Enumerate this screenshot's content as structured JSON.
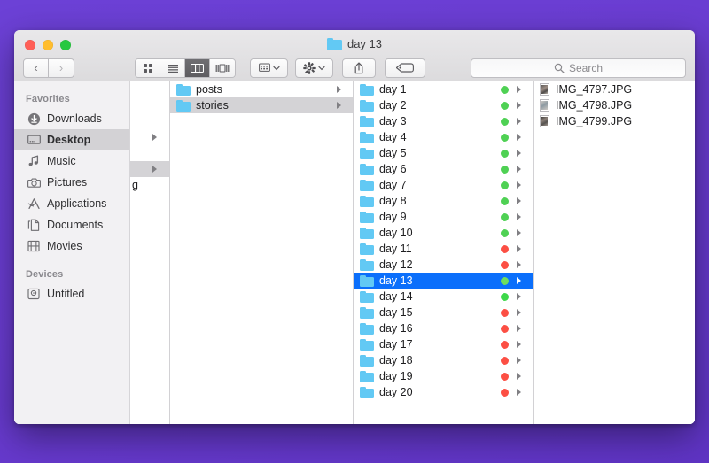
{
  "window": {
    "title": "day 13",
    "traffic_lights": [
      "close",
      "minimize",
      "zoom"
    ]
  },
  "toolbar": {
    "back_label": "‹",
    "forward_label": "›",
    "view_modes": [
      {
        "name": "icon-view",
        "active": false
      },
      {
        "name": "list-view",
        "active": false
      },
      {
        "name": "column-view",
        "active": true
      },
      {
        "name": "gallery-view",
        "active": false
      }
    ],
    "arrange_label": "arrange-by",
    "action_label": "action-gear",
    "share_label": "share",
    "tags_label": "tags",
    "search_placeholder": "Search",
    "search_value": ""
  },
  "sidebar": {
    "sections": [
      {
        "header": "Favorites",
        "items": [
          {
            "label": "Downloads",
            "icon": "downloads-icon",
            "selected": false
          },
          {
            "label": "Desktop",
            "icon": "desktop-icon",
            "selected": true
          },
          {
            "label": "Music",
            "icon": "music-icon",
            "selected": false
          },
          {
            "label": "Pictures",
            "icon": "pictures-icon",
            "selected": false
          },
          {
            "label": "Applications",
            "icon": "applications-icon",
            "selected": false
          },
          {
            "label": "Documents",
            "icon": "documents-icon",
            "selected": false
          },
          {
            "label": "Movies",
            "icon": "movies-icon",
            "selected": false
          }
        ]
      },
      {
        "header": "Devices",
        "items": [
          {
            "label": "Untitled",
            "icon": "harddisk-icon",
            "selected": false
          }
        ]
      }
    ]
  },
  "columns": {
    "hidden_column": {
      "partial_text": "g",
      "rows": [
        {
          "disclosure": false,
          "selected": false
        },
        {
          "disclosure": false,
          "selected": false
        },
        {
          "disclosure": false,
          "selected": false
        },
        {
          "disclosure": true,
          "selected": false
        },
        {
          "disclosure": false,
          "selected": false
        },
        {
          "disclosure": true,
          "selected": true
        },
        {
          "disclosure": false,
          "selected": false
        }
      ]
    },
    "folders_column": {
      "items": [
        {
          "label": "posts",
          "selected": false,
          "disclosure": true,
          "tag": null
        },
        {
          "label": "stories",
          "selected": true,
          "disclosure": true,
          "tag": null
        }
      ]
    },
    "days_column": {
      "items": [
        {
          "label": "day 1",
          "tag": "#4fd154",
          "selected": false,
          "disclosure": true
        },
        {
          "label": "day 2",
          "tag": "#4fd154",
          "selected": false,
          "disclosure": true
        },
        {
          "label": "day 3",
          "tag": "#4fd154",
          "selected": false,
          "disclosure": true
        },
        {
          "label": "day 4",
          "tag": "#4fd154",
          "selected": false,
          "disclosure": true
        },
        {
          "label": "day 5",
          "tag": "#4fd154",
          "selected": false,
          "disclosure": true
        },
        {
          "label": "day 6",
          "tag": "#4fd154",
          "selected": false,
          "disclosure": true
        },
        {
          "label": "day 7",
          "tag": "#4fd154",
          "selected": false,
          "disclosure": true
        },
        {
          "label": "day 8",
          "tag": "#4fd154",
          "selected": false,
          "disclosure": true
        },
        {
          "label": "day 9",
          "tag": "#4fd154",
          "selected": false,
          "disclosure": true
        },
        {
          "label": "day 10",
          "tag": "#4fd154",
          "selected": false,
          "disclosure": true
        },
        {
          "label": "day 11",
          "tag": "#fc4f44",
          "selected": false,
          "disclosure": true
        },
        {
          "label": "day 12",
          "tag": "#fc4f44",
          "selected": false,
          "disclosure": true
        },
        {
          "label": "day 13",
          "tag": "#6ede5e",
          "selected": true,
          "disclosure": true
        },
        {
          "label": "day 14",
          "tag": "#3ed84a",
          "selected": false,
          "disclosure": true
        },
        {
          "label": "day 15",
          "tag": "#fc4f44",
          "selected": false,
          "disclosure": true
        },
        {
          "label": "day 16",
          "tag": "#fc4f44",
          "selected": false,
          "disclosure": true
        },
        {
          "label": "day 17",
          "tag": "#fc4f44",
          "selected": false,
          "disclosure": true
        },
        {
          "label": "day 18",
          "tag": "#fc4f44",
          "selected": false,
          "disclosure": true
        },
        {
          "label": "day 19",
          "tag": "#fc4f44",
          "selected": false,
          "disclosure": true
        },
        {
          "label": "day 20",
          "tag": "#fc4f44",
          "selected": false,
          "disclosure": true
        }
      ]
    },
    "files_column": {
      "items": [
        {
          "label": "IMG_4797.JPG",
          "thumb": "t1"
        },
        {
          "label": "IMG_4798.JPG",
          "thumb": "t2"
        },
        {
          "label": "IMG_4799.JPG",
          "thumb": "t3"
        }
      ]
    }
  },
  "colors": {
    "desktop": "#6a3cd1",
    "selection_active": "#0b6ffb",
    "selection_inactive": "#d4d3d6",
    "folder_blue": "#62c9f4",
    "tag_green": "#4fd154",
    "tag_red": "#fc4f44"
  }
}
